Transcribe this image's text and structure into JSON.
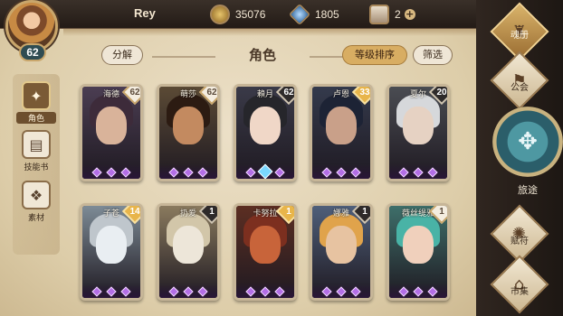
{
  "player": {
    "name": "Rey",
    "level": "62"
  },
  "resources": {
    "gold": "35076",
    "crystal": "1805",
    "box": "2"
  },
  "side_nav": [
    {
      "label": "角色",
      "icon": "hero-icon",
      "active": true
    },
    {
      "label": "技能书",
      "icon": "skill-book-icon",
      "active": false
    },
    {
      "label": "素材",
      "icon": "material-icon",
      "active": false
    }
  ],
  "header": {
    "decompose_label": "分解",
    "title": "角色",
    "sort_label": "等级排序",
    "filter_label": "筛选"
  },
  "cards": [
    {
      "name": "海德",
      "badge": "62",
      "badge_style": "light",
      "skin": "#d9b39a",
      "hair": "#3d2b3a",
      "bg": "#4b3d52"
    },
    {
      "name": "萌莎",
      "badge": "62",
      "badge_style": "light",
      "skin": "#c38a60",
      "hair": "#2c1b12",
      "bg": "#5b4a35"
    },
    {
      "name": "賴月",
      "badge": "62",
      "badge_style": "dark",
      "skin": "#f0d7c7",
      "hair": "#26262b",
      "bg": "#3a3a48",
      "selected": true
    },
    {
      "name": "卢恩",
      "badge": "33",
      "badge_style": "gold",
      "skin": "#c9a089",
      "hair": "#1d2335",
      "bg": "#343a4c"
    },
    {
      "name": "夏尔",
      "badge": "20",
      "badge_style": "dark",
      "skin": "#e6d2c3",
      "hair": "#d6d8db",
      "bg": "#4a4c52"
    },
    {
      "name": "子苍",
      "badge": "14",
      "badge_style": "gold",
      "skin": "#e9eef2",
      "hair": "#bfc6cc",
      "bg": "#7d8b96"
    },
    {
      "name": "扔爱",
      "badge": "1",
      "badge_style": "dark",
      "skin": "#ede6d9",
      "hair": "#d2c6a9",
      "bg": "#8a7a5e"
    },
    {
      "name": "卡努拉",
      "badge": "1",
      "badge_style": "gold",
      "skin": "#c8643a",
      "hair": "#7c2f1f",
      "bg": "#5c2e22"
    },
    {
      "name": "娜雅",
      "badge": "1",
      "badge_style": "dark",
      "skin": "#e7c3a1",
      "hair": "#e0a34b",
      "bg": "#4f5f7a"
    },
    {
      "name": "薇丝缇雅",
      "badge": "1",
      "badge_style": "light",
      "skin": "#f0d0bc",
      "hair": "#49b3a6",
      "bg": "#3e6f6a"
    }
  ],
  "right_nav": [
    {
      "label": "魂册",
      "icon": "soul-book-icon",
      "hilite": true
    },
    {
      "label": "公会",
      "icon": "guild-icon",
      "hilite": false
    },
    {
      "label": "旅途",
      "icon": "journey-icon",
      "hilite": false
    },
    {
      "label": "赋符",
      "icon": "rune-icon",
      "hilite": false
    },
    {
      "label": "市集",
      "icon": "market-icon",
      "hilite": false
    }
  ],
  "colors": {
    "parchment": "#e3d5b7",
    "accent_gold": "#d8ad62",
    "gem_purple": "#b36ee6"
  }
}
